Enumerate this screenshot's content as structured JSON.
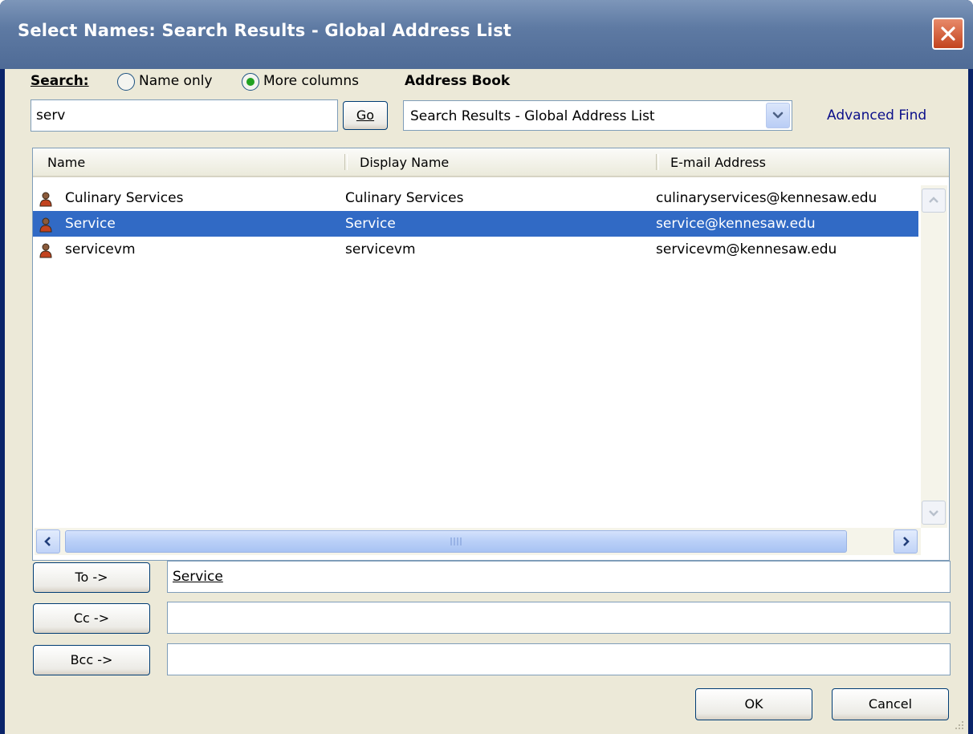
{
  "window": {
    "title": "Select Names: Search Results - Global Address List"
  },
  "search": {
    "label": "Search:",
    "option_name_only": "Name only",
    "option_more_columns": "More columns",
    "selected_option": "More columns",
    "query_value": "serv",
    "go_label": "Go"
  },
  "address_book": {
    "label": "Address Book",
    "selected": "Search Results - Global Address List",
    "advanced_find": "Advanced Find"
  },
  "table": {
    "columns": [
      "Name",
      "Display Name",
      "E-mail Address"
    ],
    "rows": [
      {
        "name": "Culinary Services",
        "display_name": "Culinary Services",
        "email": "culinaryservices@kennesaw.edu",
        "selected": false
      },
      {
        "name": "Service",
        "display_name": "Service",
        "email": "service@kennesaw.edu",
        "selected": true
      },
      {
        "name": "servicevm",
        "display_name": "servicevm",
        "email": "servicevm@kennesaw.edu",
        "selected": false
      }
    ]
  },
  "recipients": {
    "to_label": "To ->",
    "to_value": "Service",
    "cc_label": "Cc ->",
    "cc_value": "",
    "bcc_label": "Bcc ->",
    "bcc_value": ""
  },
  "footer": {
    "ok_label": "OK",
    "cancel_label": "Cancel"
  },
  "colors": {
    "selection": "#316ac5",
    "titlebar": "#5e7aa3",
    "face": "#ece9d8",
    "link": "#0b0f8a"
  }
}
